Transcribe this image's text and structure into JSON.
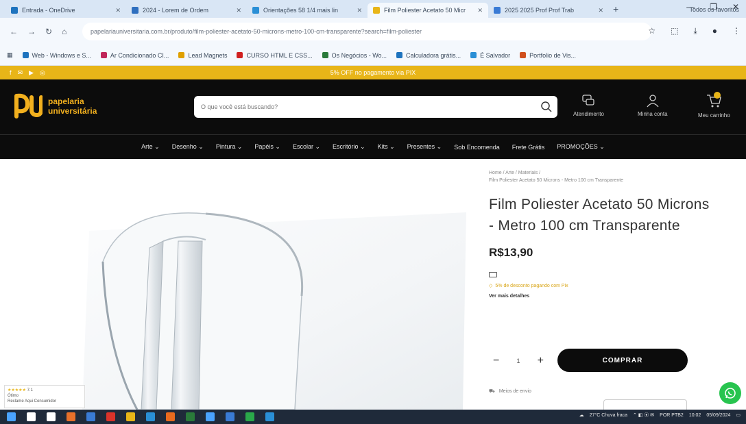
{
  "browser": {
    "tabs": [
      {
        "label": "Entrada - OneDrive",
        "color": "#1e73be",
        "active": false
      },
      {
        "label": "2024 - Lorem de Ordem",
        "color": "#2f6fbf",
        "active": false
      },
      {
        "label": "Orientações 58 1/4 mais lin",
        "color": "#2a8fd6",
        "active": false
      },
      {
        "label": "Film Poliester Acetato 50 Micr",
        "color": "#e8b518",
        "active": true
      },
      {
        "label": "2025 2025 Prof Prof Trab",
        "color": "#3a7bd5",
        "active": false
      }
    ],
    "new_tab": "+",
    "window_controls": [
      "—",
      "❐",
      "✕"
    ],
    "url": "papelariauniversitaria.com.br/produto/film-poliester-acetato-50-microns-metro-100-cm-transparente?search=film-poliester",
    "nav_buttons": [
      "←",
      "→",
      "↻",
      "⌂"
    ],
    "bookmarks": [
      {
        "label": "Web - Windows e S...",
        "color": "#1e73be"
      },
      {
        "label": "Ar Condicionado CI...",
        "color": "#c0265a"
      },
      {
        "label": "Lead Magnets",
        "color": "#e0a000"
      },
      {
        "label": "CURSO HTML E CSS...",
        "color": "#d02020"
      },
      {
        "label": "Os Negócios - Wo...",
        "color": "#2a7a3a"
      },
      {
        "label": "Calculadora grátis...",
        "color": "#1e73be"
      },
      {
        "label": "É Salvador",
        "color": "#2a8fd6"
      },
      {
        "label": "Portfolio de Vis...",
        "color": "#d0501e"
      }
    ],
    "bookmarks_right": "Todos os favoritos"
  },
  "promo": {
    "text": "5% OFF no pagamento via PIX",
    "social": [
      "f",
      "✉",
      "▶",
      "◎"
    ]
  },
  "header": {
    "logo_line1": "papelaria",
    "logo_line2": "universitária",
    "search_placeholder": "O que você está buscando?",
    "actions": [
      {
        "label": "Atendimento",
        "icon": "chat-icon"
      },
      {
        "label": "Minha conta",
        "icon": "user-icon"
      },
      {
        "label": "Meu carrinho",
        "icon": "cart-icon"
      }
    ]
  },
  "categories": [
    "Arte ⌄",
    "Desenho ⌄",
    "Pintura ⌄",
    "Papéis ⌄",
    "Escolar ⌄",
    "Escritório ⌄",
    "Kits ⌄",
    "Presentes ⌄",
    "Sob Encomenda",
    "Frete Grátis",
    "PROMOÇÕES ⌄"
  ],
  "product": {
    "breadcrumb_line1": "Home / Arte / Materiais /",
    "breadcrumb_line2": "Film Poliester Acetato 50 Microns - Metro 100 cm Transparente",
    "title": "Film Poliester Acetato 50 Microns - Metro 100 cm Transparente",
    "price": "R$13,90",
    "pix_text": "5% de desconto pagando com Pix",
    "more_payment": "Ver mais detalhes",
    "qty_minus": "−",
    "qty_value": "1",
    "qty_plus": "+",
    "buy_label": "COMPRAR",
    "shipping_label": "Meios de envio"
  },
  "rating_widget": {
    "stars": "★★★★★",
    "score": "7.1",
    "line2": "Ótimo",
    "line3": "Reclame Aqui Consumidor"
  },
  "taskbar": {
    "icons": [
      "#4aa3ff",
      "#ffffff",
      "#ffffff",
      "#e8702a",
      "#3a7bd5",
      "#d9332a",
      "#e8b518",
      "#2a8fd6",
      "#e86a1e",
      "#2a7a3a",
      "#4aa3ff",
      "#3a7bd5",
      "#2aa84a",
      "#2a8fd6"
    ],
    "weather": "27°C Chuva fraca",
    "lang": "POR PTB2",
    "time": "10:02",
    "date": "05/09/2024"
  }
}
